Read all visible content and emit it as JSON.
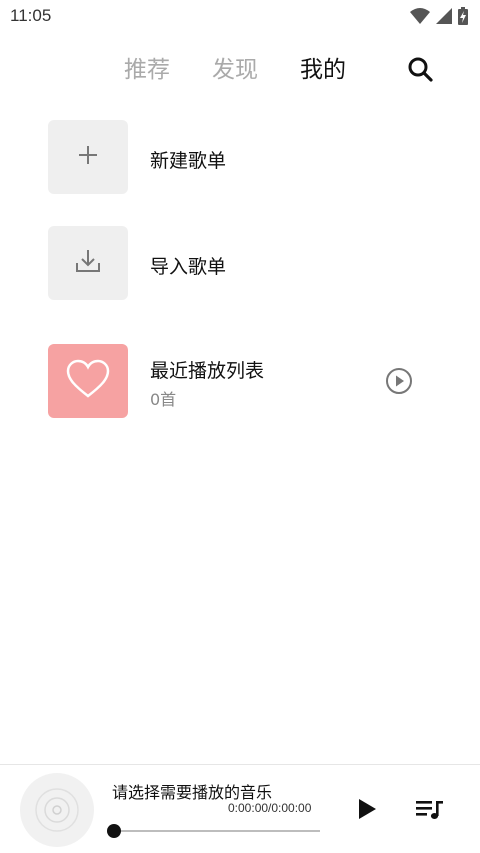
{
  "status_bar": {
    "time": "11:05",
    "icons": [
      "wifi-icon",
      "signal-icon",
      "battery-icon"
    ]
  },
  "nav": {
    "tabs": [
      {
        "label": "推荐",
        "active": false
      },
      {
        "label": "发现",
        "active": false
      },
      {
        "label": "我的",
        "active": true
      }
    ],
    "search_icon": "search-icon"
  },
  "playlists": {
    "new": {
      "label": "新建歌单",
      "icon": "plus-icon"
    },
    "import": {
      "label": "导入歌单",
      "icon": "download-icon"
    },
    "recent": {
      "label": "最近播放列表",
      "count": "0首",
      "icon": "heart-icon",
      "action_icon": "play-circle-icon"
    }
  },
  "player": {
    "title": "请选择需要播放的音乐",
    "time": "0:00:00/0:00:00",
    "progress": 0,
    "icons": [
      "disc-icon",
      "play-icon",
      "queue-icon"
    ]
  },
  "colors": {
    "favorite_bg": "#f6a2a2",
    "tile_bg": "#efefef",
    "inactive_tab": "#aaaaaa",
    "active_tab": "#111111"
  }
}
